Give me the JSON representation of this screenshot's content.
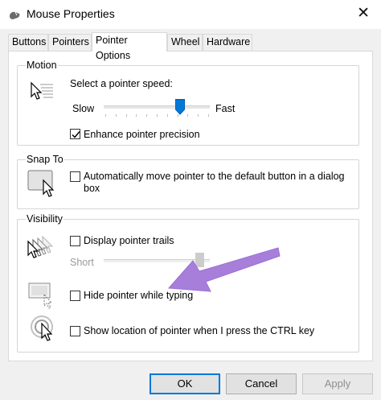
{
  "window": {
    "title": "Mouse Properties",
    "close_glyph": "✕",
    "icon": "mouse-icon"
  },
  "tabs": [
    {
      "label": "Buttons"
    },
    {
      "label": "Pointers"
    },
    {
      "label": "Pointer Options",
      "active": true
    },
    {
      "label": "Wheel"
    },
    {
      "label": "Hardware"
    }
  ],
  "motion": {
    "group_label": "Motion",
    "speed_label": "Select a pointer speed:",
    "slow_label": "Slow",
    "fast_label": "Fast",
    "speed_level": 0.72,
    "precision_label": "Enhance pointer precision",
    "precision_checked": true,
    "icon": "pointer-speed-icon"
  },
  "snap_to": {
    "group_label": "Snap To",
    "auto_label_line1": "Automatically move pointer to the default button in a dialog",
    "auto_label_line2": "box",
    "auto_checked": false,
    "icon": "snap-to-button-icon"
  },
  "visibility": {
    "group_label": "Visibility",
    "trails_label": "Display pointer trails",
    "trails_checked": false,
    "trails_short_label": "Short",
    "hide_label": "Hide pointer while typing",
    "hide_checked": false,
    "show_location_label": "Show location of pointer when I press the CTRL key",
    "show_location_checked": false
  },
  "annotation": {
    "color": "#a77fdb",
    "icon": "annotation-arrow-icon"
  },
  "buttons": {
    "ok": "OK",
    "cancel": "Cancel",
    "apply": "Apply"
  },
  "colors": {
    "accent": "#0078d7",
    "window_bg": "#f0f0f0",
    "panel_bg": "#ffffff"
  }
}
